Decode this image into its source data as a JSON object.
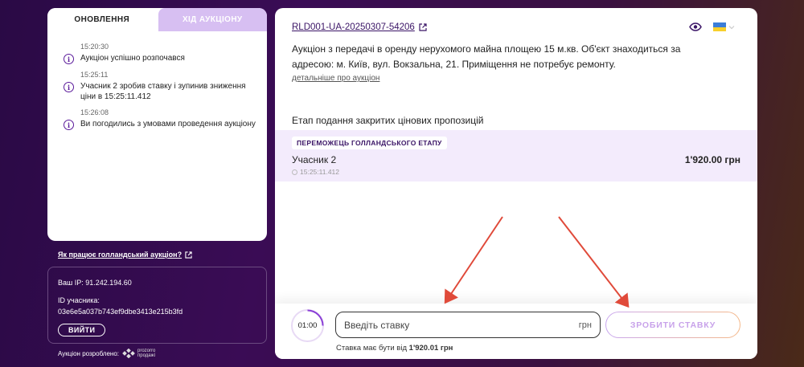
{
  "left_panel": {
    "tabs": [
      {
        "label": "ОНОВЛЕННЯ",
        "active": true
      },
      {
        "label": "ХІД АУКЦІОНУ",
        "active": false
      }
    ],
    "updates": [
      {
        "time": "15:20:30",
        "text": "Аукціон успішно розпочався"
      },
      {
        "time": "15:25:11",
        "text": "Учасник 2 зробив ставку і зупинив зниження ціни в 15:25:11.412"
      },
      {
        "time": "15:26:08",
        "text": "Ви погодились з умовами проведення аукціону"
      }
    ],
    "info_icon": "info-circle-icon"
  },
  "how_link": "Як працює голландський аукціон?",
  "user_info": {
    "ip_line": "Ваш IP: 91.242.194.60",
    "id_label": "ID учасника:",
    "id_value": "03e6e5a037b743ef9dbe3413e215b3fd",
    "logout_label": "ВИЙТИ"
  },
  "developer": {
    "label": "Аукціон розроблено:",
    "logo_line1": "prozorro",
    "logo_line2": "продажі"
  },
  "auction": {
    "id": "RLD001-UA-20250307-54206",
    "description": "Аукціон з передачі в оренду нерухомого майна площею 15 м.кв. Об'єкт знаходиться за адресою: м. Київ, вул. Вокзальна, 21. Приміщення не потребує ремонту.",
    "details_link": "детальніше про аукціон",
    "stage_title": "Етап подання закритих цінових пропозицій",
    "winner": {
      "badge": "ПЕРЕМОЖЕЦЬ ГОЛЛАНДСЬКОГО ЕТАПУ",
      "name": "Учасник 2",
      "amount": "1'920.00 грн",
      "time": "15:25:11.412"
    }
  },
  "bid": {
    "timer": "01:00",
    "placeholder": "Введіть ставку",
    "currency": "грн",
    "button_label": "ЗРОБИТИ СТАВКУ",
    "min_prefix": "Ставка має бути від",
    "min_value": "1'920.01",
    "min_currency": "грн"
  },
  "colors": {
    "accent": "#3a1466",
    "annotation_arrow": "#e04a3a",
    "flag_blue": "#3b7dd8",
    "flag_yellow": "#f7d02c"
  }
}
